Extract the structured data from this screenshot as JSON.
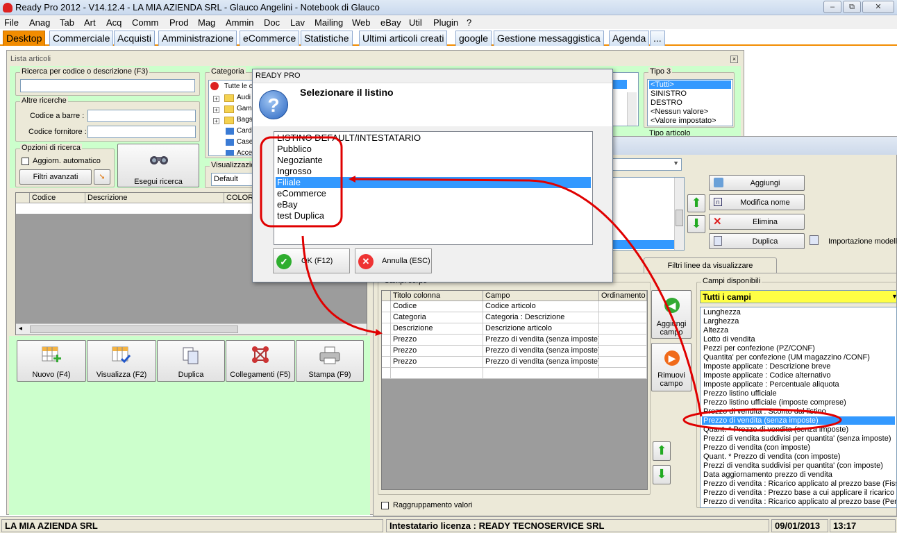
{
  "window": {
    "title": "Ready Pro 2012 - V14.12.4 - LA MIA AZIENDA SRL - Glauco Angelini - Notebook di Glauco",
    "min_glyph": "–",
    "max_glyph": "⧉",
    "close_glyph": "✕"
  },
  "menu": [
    "File",
    "Anag",
    "Tab",
    "Art",
    "Acq",
    "Comm",
    "Prod",
    "Mag",
    "Ammin",
    "Doc",
    "Lav",
    "Mailing",
    "Web",
    "eBay",
    "Util",
    "Plugin",
    "?"
  ],
  "tabs": [
    "Desktop",
    "Commerciale",
    "Acquisti",
    "Amministrazione",
    "eCommerce",
    "Statistiche",
    "Ultimi articoli creati",
    "google",
    "Gestione messaggistica",
    "Agenda",
    "..."
  ],
  "lista": {
    "title": "Lista articoli",
    "ricerca_label": "Ricerca per codice o descrizione (F3)",
    "altre_ricerche": "Altre ricerche",
    "codice_barre": "Codice a barre :",
    "codice_fornitore": "Codice fornitore :",
    "opzioni": "Opzioni di ricerca",
    "aggiorn": "Aggiorn. automatico",
    "filtri": "Filtri avanzati",
    "esegui": "Esegui ricerca",
    "categoria": "Categoria",
    "cat_items": [
      "Tutte le c",
      "Audi",
      "Gam",
      "Bags",
      "Card",
      "Case",
      "Acce"
    ],
    "visualizzazione": "Visualizzazio",
    "vis_value": "Default",
    "tipo3": "Tipo 3",
    "tipo3_items": [
      "<Tutti>",
      "SINISTRO",
      "DESTRO",
      "<Nessun valore>",
      "<Valore impostato>"
    ],
    "tipo_articolo": "Tipo articolo",
    "grid_headers": [
      "Codice",
      "Descrizione",
      "COLOR"
    ],
    "scroll_left": "◂",
    "buttons": [
      "Nuovo (F4)",
      "Visualizza (F2)",
      "Duplica",
      "Collegamenti (F5)",
      "Stampa (F9)"
    ]
  },
  "config": {
    "side_buttons": [
      "Aggiungi",
      "Modifica nome",
      "Elimina",
      "Duplica"
    ],
    "importazione": "Importazione modello",
    "filtri_tab": "Filtri linee da visualizzare",
    "campi_corpo": "Campi corpo",
    "col_headers": [
      "Titolo colonna",
      "Campo",
      "Ordinamento"
    ],
    "rows": [
      [
        "Codice",
        "Codice articolo"
      ],
      [
        "Categoria",
        "Categoria : Descrizione"
      ],
      [
        "Descrizione",
        "Descrizione articolo"
      ],
      [
        "Prezzo",
        "Prezzo di vendita (senza imposte)"
      ],
      [
        "Prezzo",
        "Prezzo di vendita (senza imposte)"
      ],
      [
        "Prezzo",
        "Prezzo di vendita (senza imposte)"
      ]
    ],
    "aggiungi_campo": "Aggiungi campo",
    "rimuovi_campo": "Rimuovi campo",
    "raggruppamento": "Raggruppamento valori",
    "campi_disponibili": "Campi disponibili",
    "tutti_campi": "Tutti i campi",
    "fields": [
      "Lunghezza",
      "Larghezza",
      "Altezza",
      "Lotto di vendita",
      "Pezzi per confezione (PZ/CONF)",
      "Quantita' per confezione (UM magazzino /CONF)",
      "Imposte applicate : Descrizione breve",
      "Imposte applicate : Codice alternativo",
      "Imposte applicate : Percentuale aliquota",
      "Prezzo listino ufficiale",
      "Prezzo listino ufficiale (imposte comprese)",
      "Prezzo di vendita : Sconto dal listino",
      "Prezzo di vendita (senza imposte)",
      "Quant. * Prezzo di vendita (senza imposte)",
      "Prezzi di vendita suddivisi per quantita' (senza imposte)",
      "Prezzo di vendita (con imposte)",
      "Quant. * Prezzo di vendita (con imposte)",
      "Prezzi di vendita suddivisi per quantita' (con imposte)",
      "Data aggiornamento prezzo di vendita",
      "Prezzo di vendita : Ricarico applicato al prezzo base (Fisso)",
      "Prezzo di vendita : Prezzo base a cui applicare il ricarico",
      "Prezzo di vendita : Ricarico applicato al prezzo base (Perc)"
    ],
    "selected_field_index": 12
  },
  "dialog": {
    "title": "READY PRO",
    "prompt": "Selezionare il listino",
    "items": [
      "LISTINO DEFAULT/INTESTATARIO",
      "Pubblico",
      "Negoziante",
      "Ingrosso",
      "Filiale",
      "eCommerce",
      "eBay",
      "test Duplica"
    ],
    "selected_index": 4,
    "ok": "OK (F12)",
    "cancel": "Annulla (ESC)"
  },
  "status": {
    "company": "LA MIA AZIENDA SRL",
    "license": "Intestatario licenza : READY TECNOSERVICE SRL",
    "date": "09/01/2013",
    "time": "13:17"
  },
  "colors": {
    "accent": "#f28c00",
    "selection": "#3399ff",
    "annotation": "#e00000",
    "panel_green": "#ccffcc"
  }
}
